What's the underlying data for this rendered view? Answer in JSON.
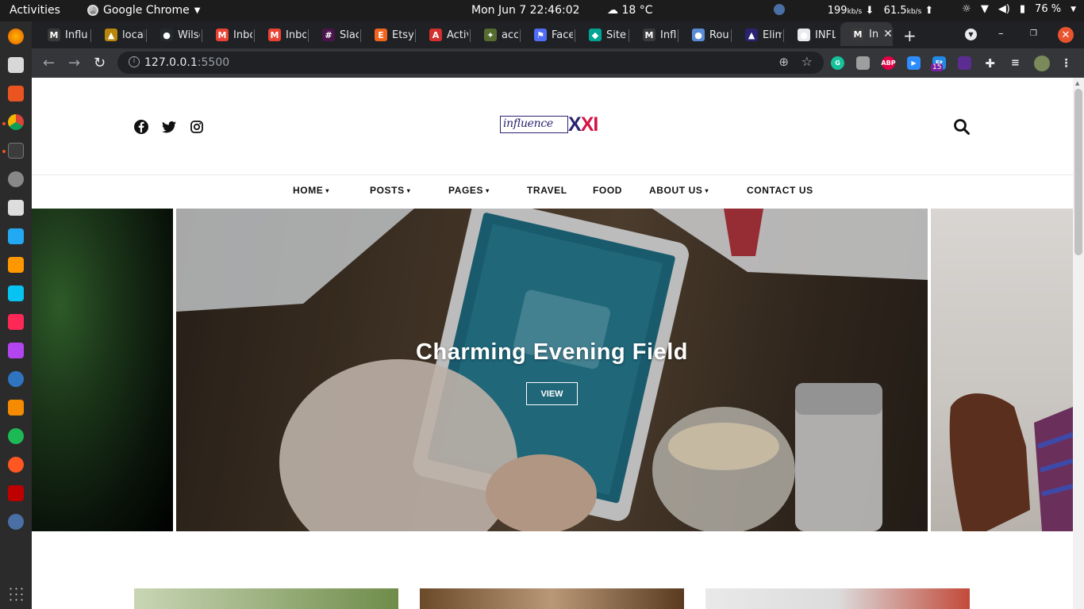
{
  "system": {
    "activities": "Activities",
    "app_name": "Google Chrome",
    "clock": "Mon Jun 7  22:46:02",
    "weather": "18 °C",
    "net_down": "199",
    "net_down_unit": "kb/s",
    "net_up": "61.5",
    "net_up_unit": "kb/s",
    "battery": "76 %"
  },
  "browser": {
    "tabs": [
      {
        "label": "Influ",
        "icon": "medium-icon",
        "color": "#000000"
      },
      {
        "label": "locall",
        "icon": "folder-icon",
        "color": "#b8860b"
      },
      {
        "label": "Wilso",
        "icon": "github-icon",
        "color": "#24292e"
      },
      {
        "label": "Inbo",
        "icon": "gmail-icon",
        "color": "#ea4335"
      },
      {
        "label": "Inbo",
        "icon": "gmail-icon",
        "color": "#ea4335"
      },
      {
        "label": "Slack",
        "icon": "slack-icon",
        "color": "#4a154b"
      },
      {
        "label": "Etsy",
        "icon": "etsy-icon",
        "color": "#f1641e"
      },
      {
        "label": "Activ",
        "icon": "pdf-icon",
        "color": "#d32f2f"
      },
      {
        "label": "acce",
        "icon": "leaf-icon",
        "color": "#556b2f"
      },
      {
        "label": "Facel",
        "icon": "flag-icon",
        "color": "#4f6df5"
      },
      {
        "label": "Site c",
        "icon": "diamond-icon",
        "color": "#00a693"
      },
      {
        "label": "Influ",
        "icon": "medium-icon",
        "color": "#000000"
      },
      {
        "label": "Roun",
        "icon": "globe-icon",
        "color": "#5b8dd6"
      },
      {
        "label": "Elimi",
        "icon": "bookmark-icon",
        "color": "#2a2270"
      },
      {
        "label": "INFLU",
        "icon": "globe-icon",
        "color": "#e8eaed"
      },
      {
        "label": "In",
        "icon": "medium-icon",
        "color": "#000000"
      }
    ],
    "url_host": "127.0.0.1",
    "url_port": ":5500",
    "extension_badge": "15"
  },
  "site": {
    "logo_word": "influence",
    "logo_xxi": "XXI",
    "nav": [
      {
        "label": "HOME",
        "dropdown": true
      },
      {
        "label": "POSTS",
        "dropdown": true
      },
      {
        "label": "PAGES",
        "dropdown": true
      },
      {
        "label": "TRAVEL",
        "dropdown": false
      },
      {
        "label": "FOOD",
        "dropdown": false
      },
      {
        "label": "ABOUT US",
        "dropdown": true
      },
      {
        "label": "CONTACT US",
        "dropdown": false
      }
    ],
    "slide_title": "Charming Evening Field",
    "slide_button": "VIEW",
    "caret": "▾"
  },
  "colors": {
    "logo_blue": "#2a2270",
    "logo_red": "#d31245",
    "ubuntu_orange": "#e95420",
    "chrome_dark": "#202124"
  }
}
